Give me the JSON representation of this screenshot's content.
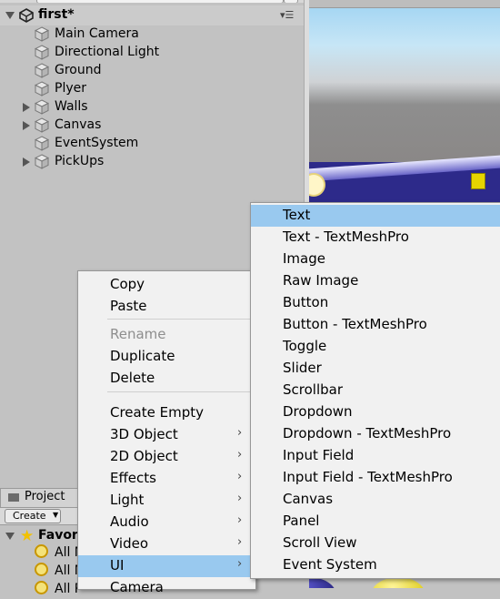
{
  "hierarchy": {
    "scene_name": "first*",
    "items": [
      {
        "label": "Main Camera",
        "expandable": false
      },
      {
        "label": "Directional Light",
        "expandable": false
      },
      {
        "label": "Ground",
        "expandable": false
      },
      {
        "label": "Plyer",
        "expandable": false
      },
      {
        "label": "Walls",
        "expandable": true
      },
      {
        "label": "Canvas",
        "expandable": true
      },
      {
        "label": "EventSystem",
        "expandable": false
      },
      {
        "label": "PickUps",
        "expandable": true
      }
    ]
  },
  "project": {
    "tab_label": "Project",
    "create_label": "Create",
    "favorites_label": "Favor",
    "searches": [
      "All M",
      "All M",
      "All P"
    ]
  },
  "context_menu": {
    "items": [
      "Copy",
      "Paste",
      "Rename",
      "Duplicate",
      "Delete",
      "Create Empty",
      "3D Object",
      "2D Object",
      "Effects",
      "Light",
      "Audio",
      "Video",
      "UI",
      "Camera"
    ],
    "disabled": [
      "Rename"
    ],
    "submenu_arrows": [
      "3D Object",
      "2D Object",
      "Effects",
      "Light",
      "Audio",
      "Video",
      "UI"
    ],
    "highlighted": "UI"
  },
  "ui_submenu": {
    "items": [
      "Text",
      "Text - TextMeshPro",
      "Image",
      "Raw Image",
      "Button",
      "Button - TextMeshPro",
      "Toggle",
      "Slider",
      "Scrollbar",
      "Dropdown",
      "Dropdown - TextMeshPro",
      "Input Field",
      "Input Field - TextMeshPro",
      "Canvas",
      "Panel",
      "Scroll View",
      "Event System"
    ],
    "highlighted": "Text"
  },
  "colors": {
    "panel_bg": "#c2c2c2",
    "menu_bg": "#f1f1f1",
    "highlight": "#99c9ef",
    "floor": "#2d2a8a",
    "pickup": "#e6d400"
  }
}
